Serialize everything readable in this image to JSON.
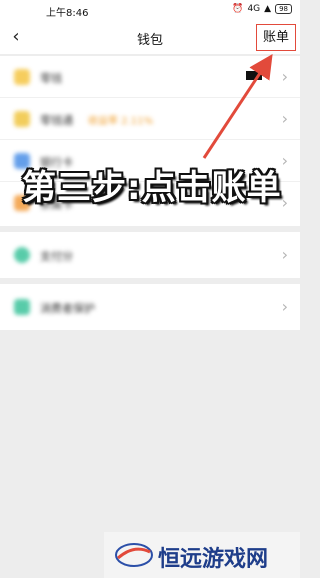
{
  "status_bar": {
    "time": "上午8:46",
    "network": "4G",
    "battery": "98"
  },
  "nav": {
    "back_icon": "back-arrow-icon",
    "title": "钱包",
    "bill_label": "账单"
  },
  "list": {
    "group1": [
      {
        "label": "零钱",
        "icon_color": "#f5c542"
      },
      {
        "label": "零钱通",
        "sub": "收益率 2.11%",
        "icon_color": "#f0c540"
      },
      {
        "label": "银行卡",
        "icon_color": "#4a8fe7"
      },
      {
        "label": "亲属卡",
        "icon_color": "#f39c3d"
      }
    ],
    "group2": [
      {
        "label": "支付分",
        "icon_color": "#3cc39b"
      }
    ],
    "group3": [
      {
        "label": "消费者保护",
        "icon_color": "#3cc39b"
      }
    ]
  },
  "overlay": {
    "instruction": "第三步:点击账单",
    "accent": "#e24a3b"
  },
  "watermark": {
    "text": "恒远游戏网"
  }
}
